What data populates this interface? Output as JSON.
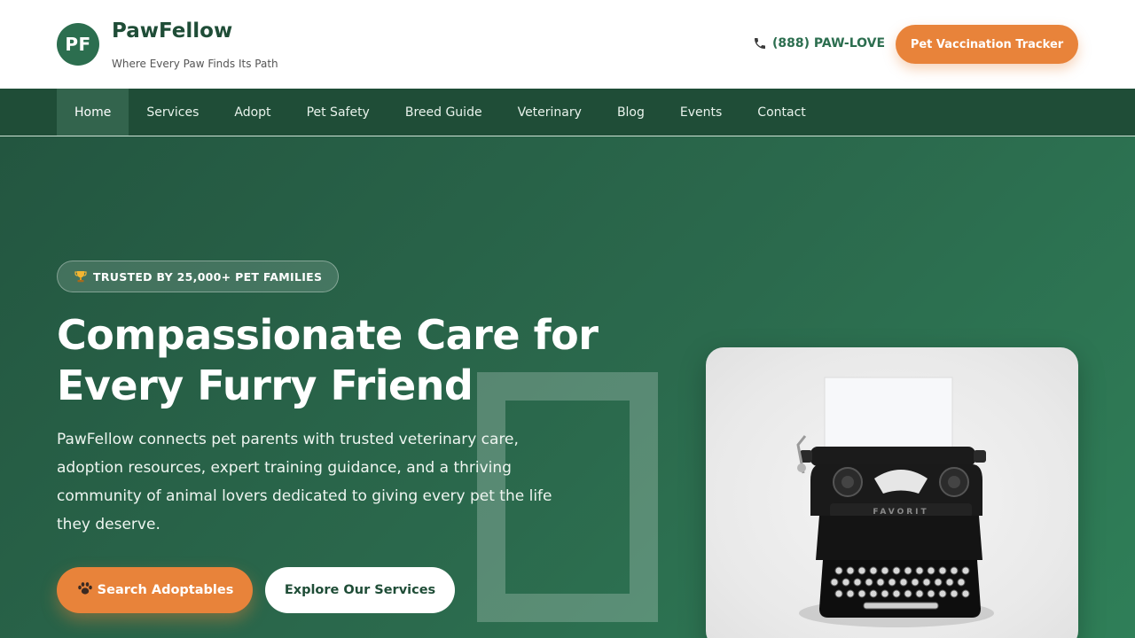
{
  "header": {
    "logo_initials": "PF",
    "brand_name": "PawFellow",
    "tagline": "Where Every Paw Finds Its Path",
    "phone": "(888) PAW-LOVE",
    "phone_icon": "phone-icon",
    "cta_label": "Pet Vaccination Tracker"
  },
  "nav": {
    "items": [
      {
        "label": "Home",
        "active": true
      },
      {
        "label": "Services"
      },
      {
        "label": "Adopt"
      },
      {
        "label": "Pet Safety"
      },
      {
        "label": "Breed Guide"
      },
      {
        "label": "Veterinary"
      },
      {
        "label": "Blog"
      },
      {
        "label": "Events"
      },
      {
        "label": "Contact"
      }
    ]
  },
  "hero": {
    "badge_icon": "trophy-icon",
    "badge_text": "TRUSTED BY 25,000+ PET FAMILIES",
    "title_line1": "Compassionate Care for",
    "title_line2": "Every Furry Friend",
    "description": "PawFellow connects pet parents with trusted veterinary care, adoption resources, expert training guidance, and a thriving community of animal lovers dedicated to giving every pet the life they deserve.",
    "primary_icon": "paw-icon",
    "primary_button": "Search Adoptables",
    "secondary_button": "Explore Our Services",
    "image_subject": "vintage typewriter with paper"
  },
  "colors": {
    "brand_green": "#1f4d37",
    "hero_green": "#2b6a4d",
    "accent_orange": "#e8833a"
  }
}
